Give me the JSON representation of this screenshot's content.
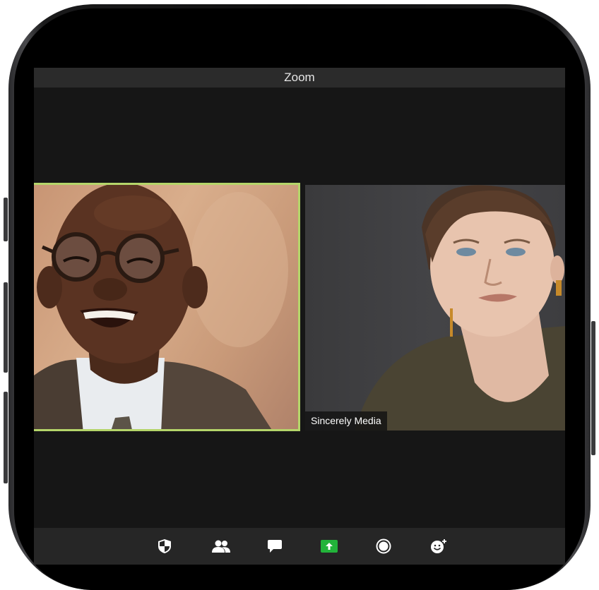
{
  "window": {
    "title": "Zoom"
  },
  "participants": [
    {
      "name": "",
      "active_speaker": true,
      "highlight_color": "#b5d56a"
    },
    {
      "name": "Sincerely Media",
      "active_speaker": false
    }
  ],
  "toolbar": {
    "buttons": [
      {
        "icon": "security-shield-icon"
      },
      {
        "icon": "participants-icon"
      },
      {
        "icon": "chat-icon"
      },
      {
        "icon": "share-screen-icon",
        "color": "#22b33a"
      },
      {
        "icon": "record-icon"
      },
      {
        "icon": "reactions-icon"
      }
    ]
  }
}
